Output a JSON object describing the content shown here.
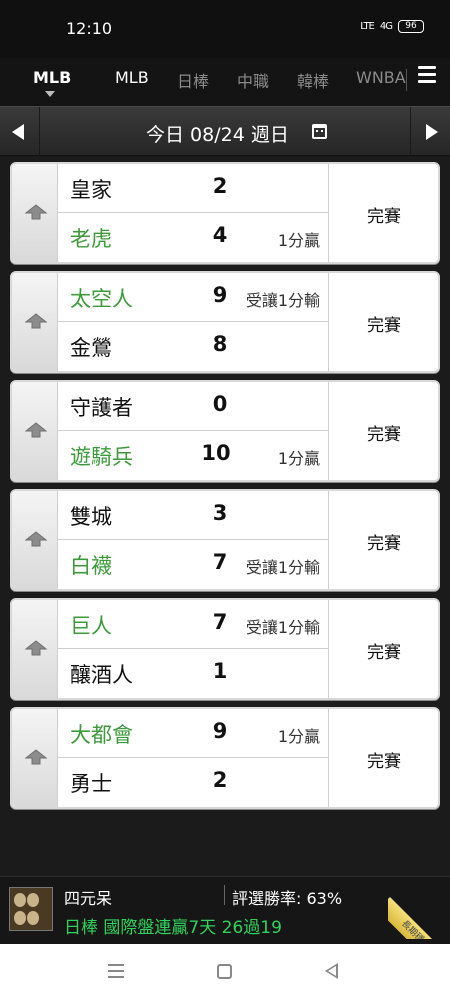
{
  "status_bar": {
    "time": "12:10",
    "network": "LTE",
    "signal": "4G",
    "battery": "96"
  },
  "tabs": [
    {
      "label": "MLB",
      "state": "active"
    },
    {
      "label": "MLB",
      "state": "normal"
    },
    {
      "label": "日棒",
      "state": "dim"
    },
    {
      "label": "中職",
      "state": "dim"
    },
    {
      "label": "韓棒",
      "state": "dim"
    },
    {
      "label": "WNBA",
      "state": "dim"
    }
  ],
  "date_bar": {
    "label": "今日 08/24 週日"
  },
  "games": [
    {
      "top": {
        "team": "皇家",
        "score": "2",
        "note": "",
        "winner": false
      },
      "bottom": {
        "team": "老虎",
        "score": "4",
        "note": "1分贏",
        "winner": true
      },
      "status": "完賽"
    },
    {
      "top": {
        "team": "太空人",
        "score": "9",
        "note": "受讓1分輸",
        "winner": true
      },
      "bottom": {
        "team": "金鶯",
        "score": "8",
        "note": "",
        "winner": false
      },
      "status": "完賽"
    },
    {
      "top": {
        "team": "守護者",
        "score": "0",
        "note": "",
        "winner": false
      },
      "bottom": {
        "team": "遊騎兵",
        "score": "10",
        "note": "1分贏",
        "winner": true
      },
      "status": "完賽"
    },
    {
      "top": {
        "team": "雙城",
        "score": "3",
        "note": "",
        "winner": false
      },
      "bottom": {
        "team": "白襪",
        "score": "7",
        "note": "受讓1分輸",
        "winner": true
      },
      "status": "完賽"
    },
    {
      "top": {
        "team": "巨人",
        "score": "7",
        "note": "受讓1分輸",
        "winner": true
      },
      "bottom": {
        "team": "釀酒人",
        "score": "1",
        "note": "",
        "winner": false
      },
      "status": "完賽"
    },
    {
      "top": {
        "team": "大都會",
        "score": "9",
        "note": "1分贏",
        "winner": true
      },
      "bottom": {
        "team": "勇士",
        "score": "2",
        "note": "",
        "winner": false
      },
      "status": "完賽"
    }
  ],
  "ad": {
    "name": "四元呆",
    "win_rate": "評選勝率: 63%",
    "promo": "日棒 國際盤連贏7天 26過19",
    "ribbon": "長期穩定"
  },
  "colors": {
    "winner_green": "#3c9a3a",
    "promo_green": "#2fd35c"
  }
}
